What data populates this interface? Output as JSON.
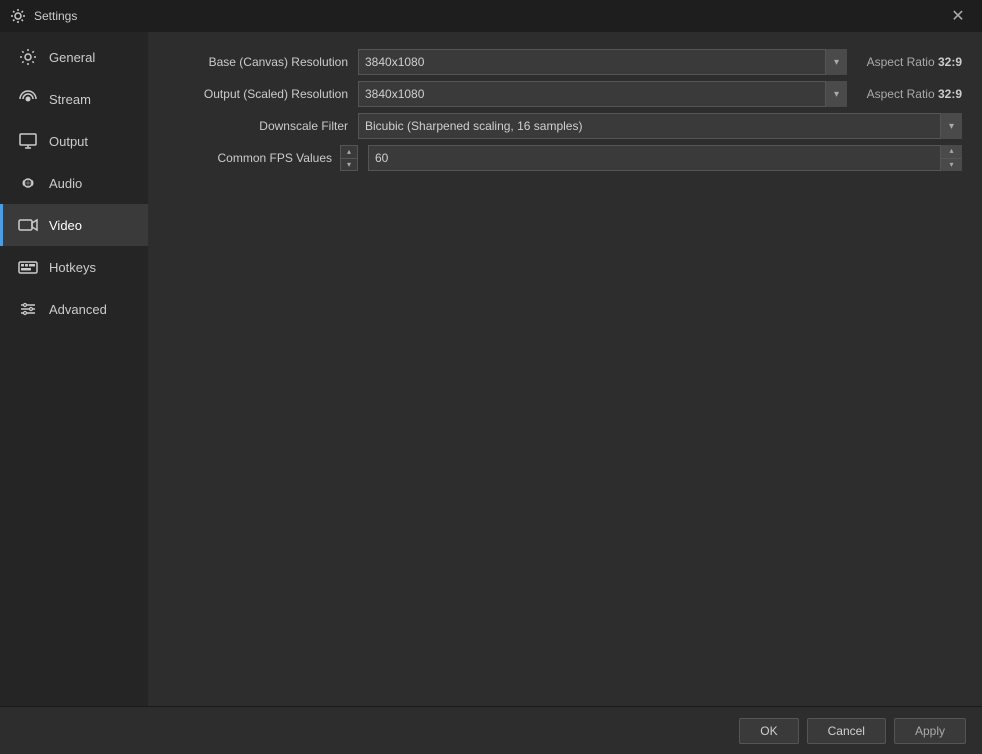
{
  "window": {
    "title": "Settings",
    "icon": "settings-icon"
  },
  "sidebar": {
    "items": [
      {
        "id": "general",
        "label": "General",
        "icon": "gear-icon",
        "active": false
      },
      {
        "id": "stream",
        "label": "Stream",
        "icon": "stream-icon",
        "active": false
      },
      {
        "id": "output",
        "label": "Output",
        "icon": "output-icon",
        "active": false
      },
      {
        "id": "audio",
        "label": "Audio",
        "icon": "audio-icon",
        "active": false
      },
      {
        "id": "video",
        "label": "Video",
        "icon": "video-icon",
        "active": true
      },
      {
        "id": "hotkeys",
        "label": "Hotkeys",
        "icon": "hotkeys-icon",
        "active": false
      },
      {
        "id": "advanced",
        "label": "Advanced",
        "icon": "advanced-icon",
        "active": false
      }
    ]
  },
  "content": {
    "rows": [
      {
        "id": "base-resolution",
        "label": "Base (Canvas) Resolution",
        "value": "3840x1080",
        "aspect_ratio_prefix": "Aspect Ratio",
        "aspect_ratio_value": "32:9",
        "type": "select-with-aspect"
      },
      {
        "id": "output-resolution",
        "label": "Output (Scaled) Resolution",
        "value": "3840x1080",
        "aspect_ratio_prefix": "Aspect Ratio",
        "aspect_ratio_value": "32:9",
        "type": "select-with-aspect"
      },
      {
        "id": "downscale-filter",
        "label": "Downscale Filter",
        "value": "Bicubic (Sharpened scaling, 16 samples)",
        "type": "select"
      },
      {
        "id": "common-fps",
        "label": "Common FPS Values",
        "value": "60",
        "type": "fps-spinner"
      }
    ]
  },
  "footer": {
    "ok_label": "OK",
    "cancel_label": "Cancel",
    "apply_label": "Apply"
  }
}
